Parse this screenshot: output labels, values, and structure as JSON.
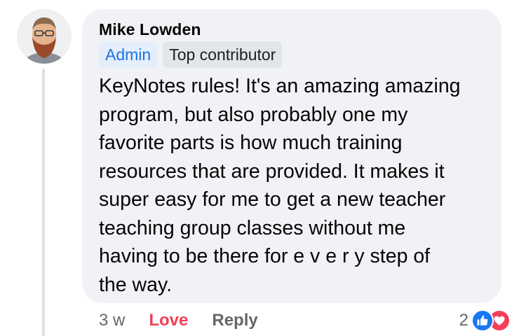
{
  "comment": {
    "author": "Mike Lowden",
    "badges": {
      "admin": "Admin",
      "top_contributor": "Top contributor"
    },
    "text": "KeyNotes rules! It's an amazing amazing\nprogram, but also probably one my\nfavorite parts is how much training\nresources that are provided. It makes it\nsuper easy for me to get a new teacher\nteaching group classes without me\nhaving to be there for e v e r y step of\nthe way.",
    "timestamp": "3 w",
    "actions": {
      "love": "Love",
      "reply": "Reply"
    },
    "reactions": {
      "count": "2",
      "types": [
        "like-icon",
        "love-icon"
      ]
    }
  },
  "colors": {
    "bubble": "#f0f2f5",
    "admin_badge_text": "#1b74e4",
    "love": "#f33e58",
    "like": "#1877f2",
    "muted_text": "#65676b"
  }
}
